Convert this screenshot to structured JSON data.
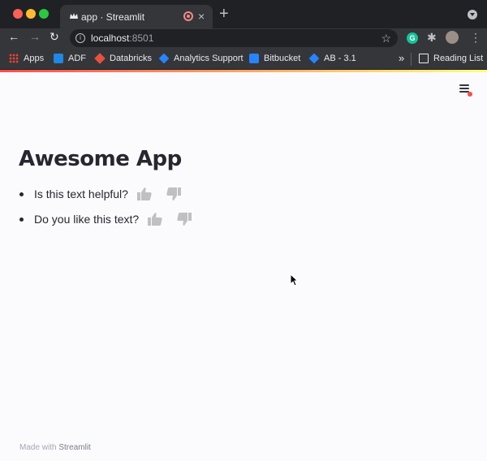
{
  "browser": {
    "tab": {
      "title": "app · Streamlit",
      "close": "×"
    },
    "new_tab": "+",
    "nav": {
      "back": "←",
      "forward": "→",
      "reload": "↻"
    },
    "url": {
      "host": "localhost",
      "port": ":8501"
    },
    "star": "☆",
    "extension_letter": "G",
    "menu": "⋮",
    "puzzle": "✱",
    "bookmarks": [
      {
        "label": "Apps",
        "icon": "apps-grid-icon"
      },
      {
        "label": "ADF",
        "icon": "adf-icon"
      },
      {
        "label": "Databricks",
        "icon": "databricks-icon"
      },
      {
        "label": "Analytics Support",
        "icon": "jira-icon"
      },
      {
        "label": "Bitbucket",
        "icon": "bitbucket-icon"
      },
      {
        "label": "AB - 3.1",
        "icon": "jira-icon"
      }
    ],
    "bookmarks_more": "»",
    "reading_list": "Reading List"
  },
  "app": {
    "title": "Awesome App",
    "questions": [
      {
        "text": "Is this text helpful?"
      },
      {
        "text": "Do you like this text?"
      }
    ],
    "footer": {
      "prefix": "Made with ",
      "link": "Streamlit"
    }
  },
  "colors": {
    "accent": "#ff4b4b",
    "text": "#262730",
    "thumb": "#bfbfc4",
    "chrome_dark": "#202124",
    "chrome_toolbar": "#35363a"
  }
}
